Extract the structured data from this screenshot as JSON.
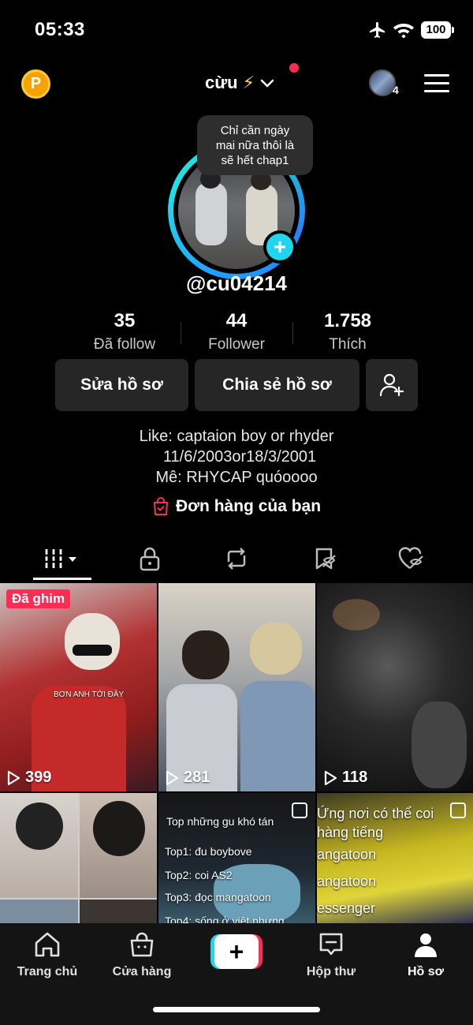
{
  "status": {
    "time": "05:33",
    "battery": "100"
  },
  "header": {
    "coin": "P",
    "account_name": "cừu",
    "account_emoji": "⚡",
    "notifications_count": "4"
  },
  "profile": {
    "note": [
      "Chỉ cần ngày",
      "mai nữa thôi là",
      "sẽ hết chap1"
    ],
    "username": "@cu04214",
    "stats": [
      {
        "value": "35",
        "label": "Đã follow"
      },
      {
        "value": "44",
        "label": "Follower"
      },
      {
        "value": "1.758",
        "label": "Thích"
      }
    ],
    "buttons": {
      "edit": "Sửa hồ sơ",
      "share": "Chia sẻ hồ sơ"
    },
    "bio": [
      "Like: captaion boy or rhyder",
      "11/6/2003or18/3/2001",
      "Mê: RHYCAP quóoooo"
    ],
    "orders": "Đơn hàng của bạn"
  },
  "videos": [
    {
      "views": "399",
      "pinned_label": "Đã ghim",
      "caption": "BƠN ANH TỚI ĐÂY"
    },
    {
      "views": "281"
    },
    {
      "views": "118"
    },
    {
      "views": ""
    },
    {
      "lines": [
        "Top những gu khó tán",
        "Top1: đu boybove",
        "Top2: coi AS2",
        "Top3: đọc mangatoon",
        "Top4: sống ở việt nhưng"
      ]
    },
    {
      "lines": [
        "Ứng nơi có thể coi",
        "hàng tiếng",
        "angatoon",
        "angatoon",
        "essenger"
      ]
    }
  ],
  "nav": {
    "home": "Trang chủ",
    "shop": "Cửa hàng",
    "inbox": "Hộp thư",
    "profile": "Hồ sơ"
  },
  "colors": {
    "accent": "#fe2c55",
    "cyan": "#20d5ec",
    "background": "#000000"
  }
}
